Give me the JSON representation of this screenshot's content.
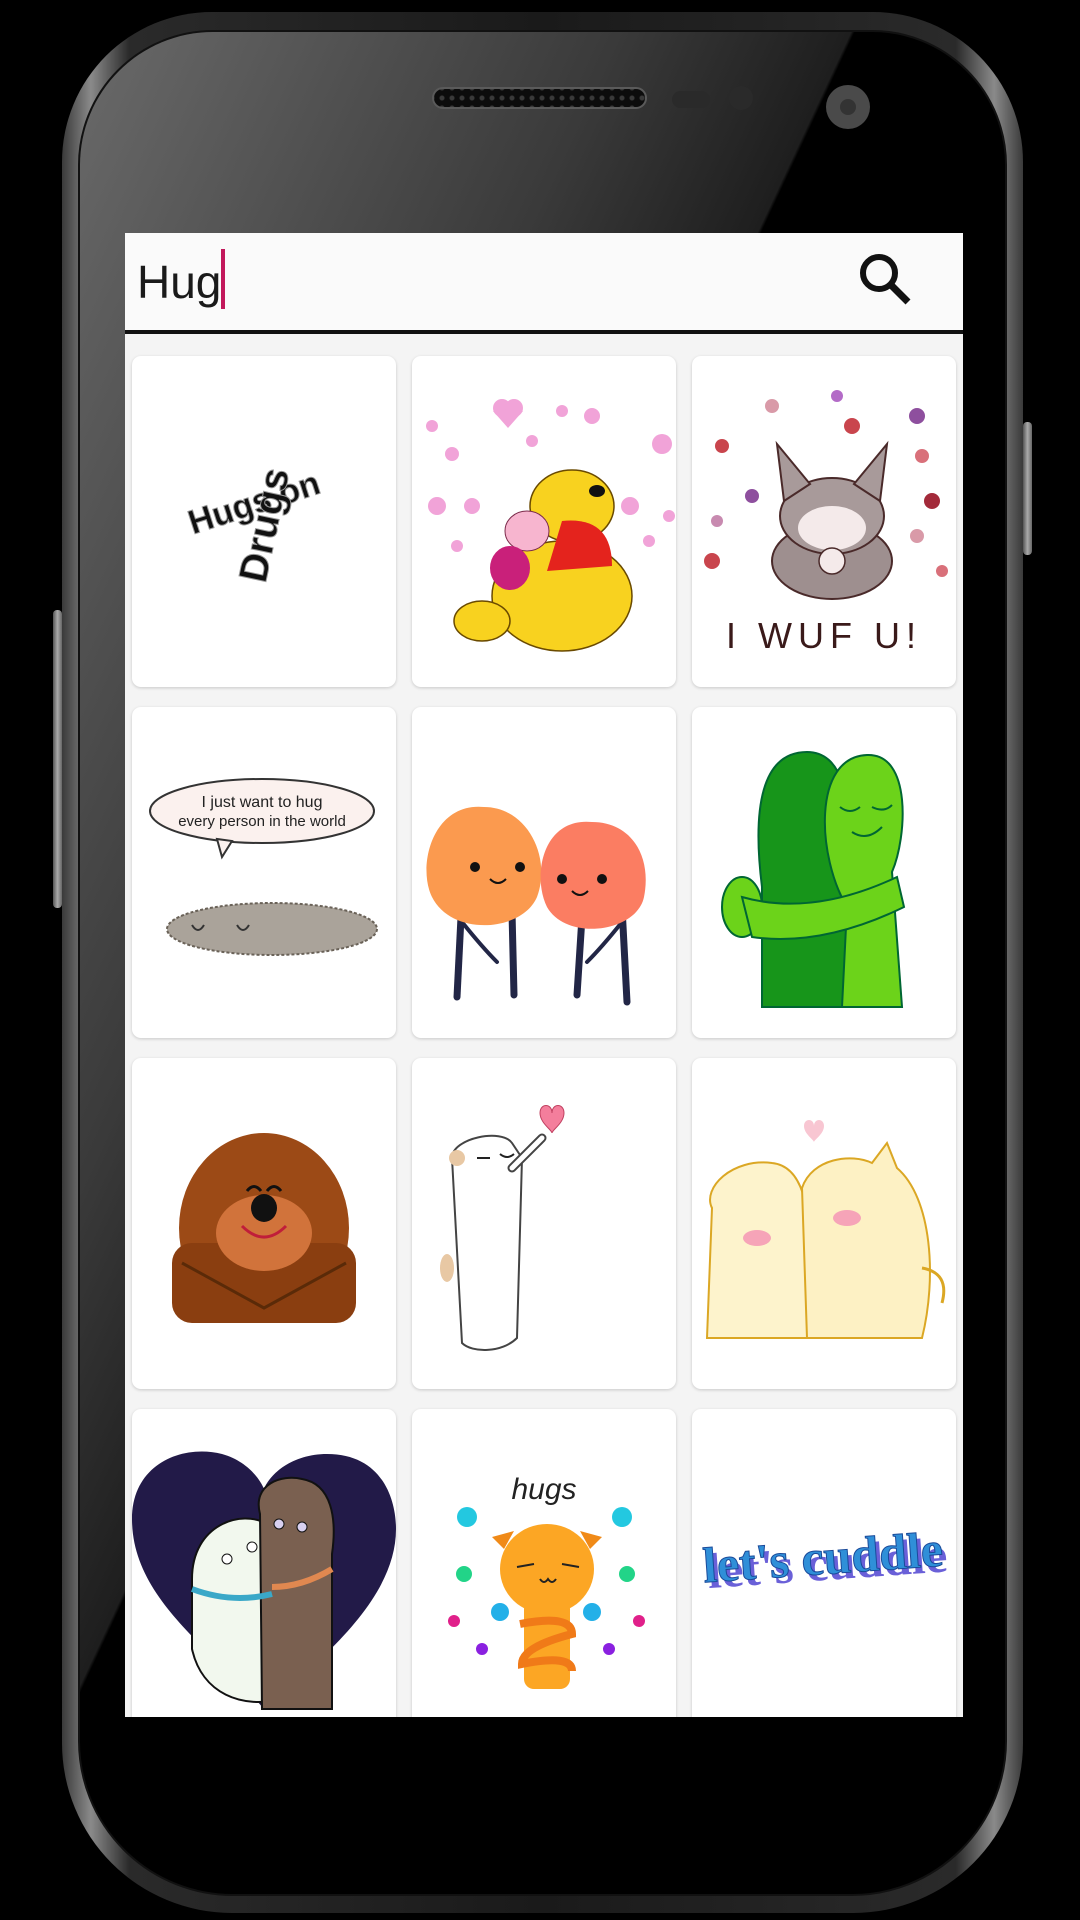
{
  "search": {
    "value": "Hug",
    "icon": "search-icon",
    "accent_caret": "#c2185b"
  },
  "stickers": [
    {
      "id": "hugs-on-drugs",
      "alt": "Hugs on Drugs 3D text",
      "text_line1": "Hugs on",
      "text_line2": "Drugs"
    },
    {
      "id": "pooh-piglet",
      "alt": "Winnie the Pooh hugging Piglet with pink hearts"
    },
    {
      "id": "wolf-wuf",
      "alt": "Grey wolf pup with hearts",
      "text": "I WUF U!"
    },
    {
      "id": "pusheen-hug",
      "alt": "Grey cat lying under speech bubble",
      "text_line1": "I just want to hug",
      "text_line2": "every person in the world"
    },
    {
      "id": "peaches-hug",
      "alt": "Two orange peach characters holding hands"
    },
    {
      "id": "green-hug",
      "alt": "Two green figures hugging"
    },
    {
      "id": "brown-bear",
      "alt": "Brown bear hugging itself"
    },
    {
      "id": "white-cat-heart",
      "alt": "White cat reaching for a pink heart"
    },
    {
      "id": "cream-cats",
      "alt": "Two cream cats cuddling with a pink heart"
    },
    {
      "id": "dogs-heart",
      "alt": "White and brown dogs hugging in a navy heart"
    },
    {
      "id": "orange-cat-hugs",
      "alt": "Orange cat hugging itself with colorful hearts",
      "text": "hugs"
    },
    {
      "id": "lets-cuddle",
      "alt": "3D blue text",
      "text": "let's cuddle"
    }
  ]
}
